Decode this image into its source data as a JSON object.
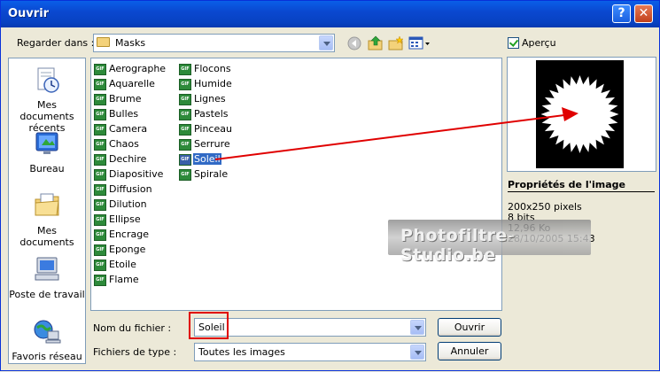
{
  "window": {
    "title": "Ouvrir",
    "help_icon": "help-icon",
    "close_icon": "close-icon"
  },
  "look_in": {
    "label": "Regarder dans :",
    "value": "Masks",
    "icon": "folder-icon"
  },
  "toolbar": {
    "icons": [
      "back-icon",
      "up-folder-icon",
      "new-folder-icon",
      "view-menu-icon"
    ]
  },
  "preview_toggle": {
    "label": "Aperçu",
    "checked": true
  },
  "places": [
    {
      "label": "Mes documents récents",
      "icon": "recent-documents-icon"
    },
    {
      "label": "Bureau",
      "icon": "desktop-icon"
    },
    {
      "label": "Mes documents",
      "icon": "my-documents-icon"
    },
    {
      "label": "Poste de travail",
      "icon": "my-computer-icon"
    },
    {
      "label": "Favoris réseau",
      "icon": "network-places-icon"
    }
  ],
  "files": {
    "col1": [
      "Aerographe",
      "Aquarelle",
      "Brume",
      "Bulles",
      "Camera",
      "Chaos",
      "Dechire",
      "Diapositive",
      "Diffusion",
      "Dilution",
      "Ellipse",
      "Encrage",
      "Eponge",
      "Etoile",
      "Flame"
    ],
    "col2": [
      "Flocons",
      "Humide",
      "Lignes",
      "Pastels",
      "Pinceau",
      "Serrure",
      "Soleil",
      "Spirale"
    ],
    "selected": "Soleil",
    "icon_label": "GIF"
  },
  "filename": {
    "label": "Nom du fichier :",
    "value": "Soleil"
  },
  "filetype": {
    "label": "Fichiers de type :",
    "value": "Toutes les images"
  },
  "buttons": {
    "open": "Ouvrir",
    "cancel": "Annuler"
  },
  "properties": {
    "title": "Propriétés de l'image",
    "dimensions": "200x250 pixels",
    "depth": "8 bits",
    "size": "12,96 Ko",
    "date": "28/10/2005 15:43"
  },
  "watermark": "Photofiltre-Studio.be",
  "colors": {
    "titlebar": "#0a48d0",
    "selection": "#316ac5",
    "annotation": "#e00000",
    "window_bg": "#ece9d8"
  }
}
